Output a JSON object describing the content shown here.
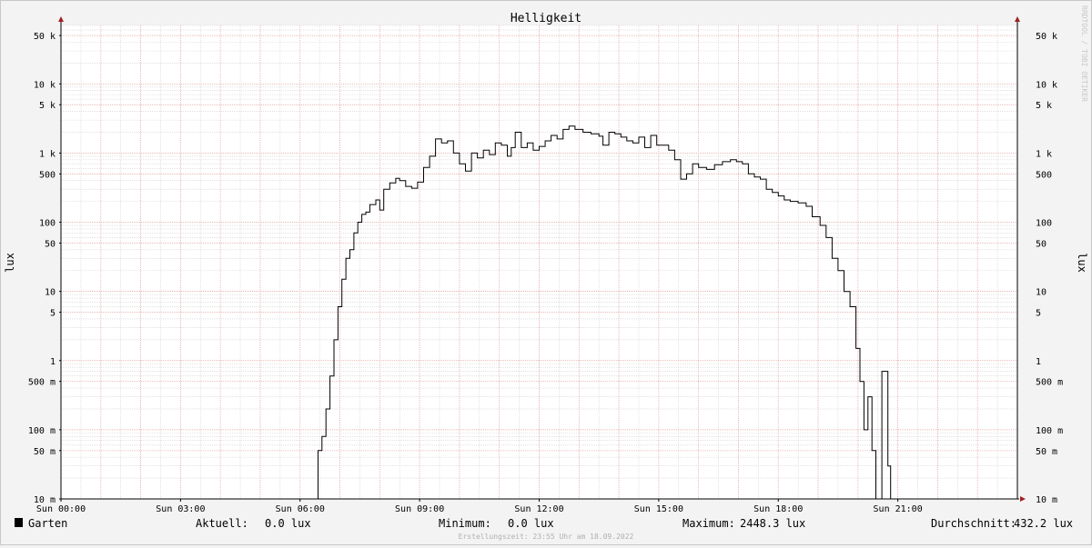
{
  "chart_data": {
    "type": "line",
    "title": "Helligkeit",
    "ylabel": "lux",
    "scale": "log",
    "ylim": [
      0.01,
      70000
    ],
    "xlim_hours": [
      0,
      24
    ],
    "y_ticks": [
      {
        "value": 0.01,
        "label": "10 m"
      },
      {
        "value": 0.05,
        "label": "50 m"
      },
      {
        "value": 0.1,
        "label": "100 m"
      },
      {
        "value": 0.5,
        "label": "500 m"
      },
      {
        "value": 1,
        "label": "1"
      },
      {
        "value": 5,
        "label": "5"
      },
      {
        "value": 10,
        "label": "10"
      },
      {
        "value": 50,
        "label": "50"
      },
      {
        "value": 100,
        "label": "100"
      },
      {
        "value": 500,
        "label": "500"
      },
      {
        "value": 1000,
        "label": "1 k"
      },
      {
        "value": 5000,
        "label": "5 k"
      },
      {
        "value": 10000,
        "label": "10 k"
      },
      {
        "value": 50000,
        "label": "50 k"
      }
    ],
    "x_ticks": [
      {
        "value": 0,
        "label": "Sun 00:00"
      },
      {
        "value": 3,
        "label": "Sun 03:00"
      },
      {
        "value": 6,
        "label": "Sun 06:00"
      },
      {
        "value": 9,
        "label": "Sun 09:00"
      },
      {
        "value": 12,
        "label": "Sun 12:00"
      },
      {
        "value": 15,
        "label": "Sun 15:00"
      },
      {
        "value": 18,
        "label": "Sun 18:00"
      },
      {
        "value": 21,
        "label": "Sun 21:00"
      }
    ],
    "series": [
      {
        "name": "Garten",
        "color": "#000000",
        "points": [
          [
            0,
            0.01
          ],
          [
            6.45,
            0.01
          ],
          [
            6.45,
            0.05
          ],
          [
            6.55,
            0.08
          ],
          [
            6.65,
            0.2
          ],
          [
            6.75,
            0.6
          ],
          [
            6.85,
            2
          ],
          [
            6.95,
            6
          ],
          [
            7.05,
            15
          ],
          [
            7.15,
            30
          ],
          [
            7.25,
            40
          ],
          [
            7.35,
            70
          ],
          [
            7.45,
            100
          ],
          [
            7.55,
            130
          ],
          [
            7.65,
            140
          ],
          [
            7.75,
            180
          ],
          [
            7.9,
            210
          ],
          [
            8.0,
            150
          ],
          [
            8.1,
            300
          ],
          [
            8.25,
            370
          ],
          [
            8.4,
            430
          ],
          [
            8.5,
            400
          ],
          [
            8.65,
            330
          ],
          [
            8.8,
            310
          ],
          [
            8.95,
            380
          ],
          [
            9.1,
            620
          ],
          [
            9.25,
            900
          ],
          [
            9.4,
            1600
          ],
          [
            9.55,
            1400
          ],
          [
            9.7,
            1500
          ],
          [
            9.85,
            1000
          ],
          [
            10.0,
            700
          ],
          [
            10.15,
            550
          ],
          [
            10.3,
            1000
          ],
          [
            10.45,
            850
          ],
          [
            10.6,
            1100
          ],
          [
            10.75,
            950
          ],
          [
            10.9,
            1400
          ],
          [
            11.05,
            1300
          ],
          [
            11.2,
            900
          ],
          [
            11.3,
            1200
          ],
          [
            11.4,
            2000
          ],
          [
            11.55,
            1200
          ],
          [
            11.7,
            1400
          ],
          [
            11.85,
            1100
          ],
          [
            12.0,
            1250
          ],
          [
            12.15,
            1500
          ],
          [
            12.3,
            1800
          ],
          [
            12.45,
            1600
          ],
          [
            12.6,
            2200
          ],
          [
            12.75,
            2448.3
          ],
          [
            12.9,
            2200
          ],
          [
            13.1,
            2000
          ],
          [
            13.3,
            1900
          ],
          [
            13.5,
            1750
          ],
          [
            13.6,
            1300
          ],
          [
            13.75,
            2000
          ],
          [
            13.9,
            1900
          ],
          [
            14.05,
            1700
          ],
          [
            14.2,
            1500
          ],
          [
            14.35,
            1400
          ],
          [
            14.5,
            1700
          ],
          [
            14.65,
            1200
          ],
          [
            14.8,
            1800
          ],
          [
            14.95,
            1300
          ],
          [
            15.1,
            1300
          ],
          [
            15.25,
            1100
          ],
          [
            15.4,
            800
          ],
          [
            15.55,
            420
          ],
          [
            15.7,
            500
          ],
          [
            15.85,
            700
          ],
          [
            16.0,
            620
          ],
          [
            16.2,
            580
          ],
          [
            16.4,
            680
          ],
          [
            16.6,
            750
          ],
          [
            16.8,
            800
          ],
          [
            16.95,
            750
          ],
          [
            17.1,
            700
          ],
          [
            17.25,
            500
          ],
          [
            17.4,
            450
          ],
          [
            17.55,
            420
          ],
          [
            17.7,
            300
          ],
          [
            17.85,
            270
          ],
          [
            18.0,
            240
          ],
          [
            18.15,
            210
          ],
          [
            18.3,
            200
          ],
          [
            18.5,
            190
          ],
          [
            18.7,
            170
          ],
          [
            18.85,
            120
          ],
          [
            19.05,
            90
          ],
          [
            19.2,
            60
          ],
          [
            19.35,
            30
          ],
          [
            19.5,
            20
          ],
          [
            19.65,
            10
          ],
          [
            19.8,
            6
          ],
          [
            19.95,
            1.5
          ],
          [
            20.05,
            0.5
          ],
          [
            20.15,
            0.1
          ],
          [
            20.25,
            0.3
          ],
          [
            20.35,
            0.05
          ],
          [
            20.45,
            0.01
          ],
          [
            20.55,
            0.01
          ],
          [
            20.6,
            0.7
          ],
          [
            20.7,
            0.7
          ],
          [
            20.75,
            0.03
          ],
          [
            20.8,
            0.03
          ],
          [
            20.82,
            0.01
          ],
          [
            24,
            0.01
          ]
        ]
      }
    ]
  },
  "legend": {
    "series_label": "Garten",
    "swatch_color": "#000000",
    "current_label": "Aktuell:",
    "current_value": "0.0 lux",
    "min_label": "Minimum:",
    "min_value": "0.0 lux",
    "max_label": "Maximum:",
    "max_value": "2448.3 lux",
    "avg_label": "Durchschnitt:",
    "avg_value": "432.2 lux"
  },
  "footer": "Erstellungszeit: 23:55 Uhr am 18.09.2022",
  "watermark": "RRDTOOL / TOBI OETIKER",
  "colors": {
    "background": "#f3f3f3",
    "plot_background": "#ffffff",
    "major_grid": "#e8a0a0",
    "minor_grid": "#d0d0d0",
    "axis_arrow": "#a02020"
  }
}
